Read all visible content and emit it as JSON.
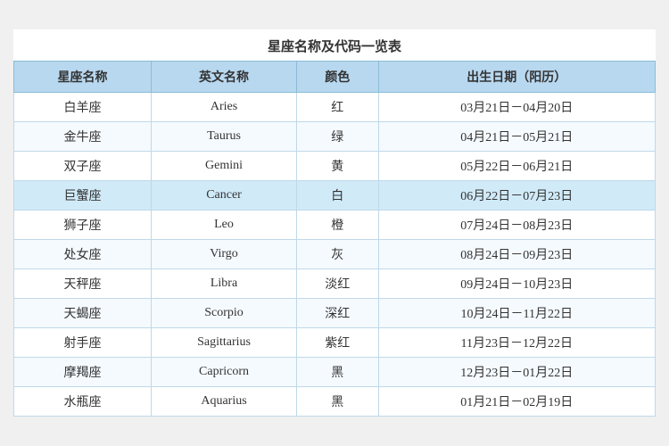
{
  "title": "星座名称及代码一览表",
  "headers": [
    "星座名称",
    "英文名称",
    "颜色",
    "出生日期（阳历）"
  ],
  "rows": [
    {
      "chinese": "白羊座",
      "english": "Aries",
      "color": "红",
      "dates": "03月21日－04月20日",
      "highlight": false
    },
    {
      "chinese": "金牛座",
      "english": "Taurus",
      "color": "绿",
      "dates": "04月21日－05月21日",
      "highlight": false
    },
    {
      "chinese": "双子座",
      "english": "Gemini",
      "color": "黄",
      "dates": "05月22日－06月21日",
      "highlight": false
    },
    {
      "chinese": "巨蟹座",
      "english": "Cancer",
      "color": "白",
      "dates": "06月22日－07月23日",
      "highlight": true
    },
    {
      "chinese": "狮子座",
      "english": "Leo",
      "color": "橙",
      "dates": "07月24日－08月23日",
      "highlight": false
    },
    {
      "chinese": "处女座",
      "english": "Virgo",
      "color": "灰",
      "dates": "08月24日－09月23日",
      "highlight": false
    },
    {
      "chinese": "天秤座",
      "english": "Libra",
      "color": "淡红",
      "dates": "09月24日－10月23日",
      "highlight": false
    },
    {
      "chinese": "天蝎座",
      "english": "Scorpio",
      "color": "深红",
      "dates": "10月24日－11月22日",
      "highlight": false
    },
    {
      "chinese": "射手座",
      "english": "Sagittarius",
      "color": "紫红",
      "dates": "11月23日－12月22日",
      "highlight": false
    },
    {
      "chinese": "摩羯座",
      "english": "Capricorn",
      "color": "黑",
      "dates": "12月23日－01月22日",
      "highlight": false
    },
    {
      "chinese": "水瓶座",
      "english": "Aquarius",
      "color": "黑",
      "dates": "01月21日－02月19日",
      "highlight": false
    }
  ]
}
